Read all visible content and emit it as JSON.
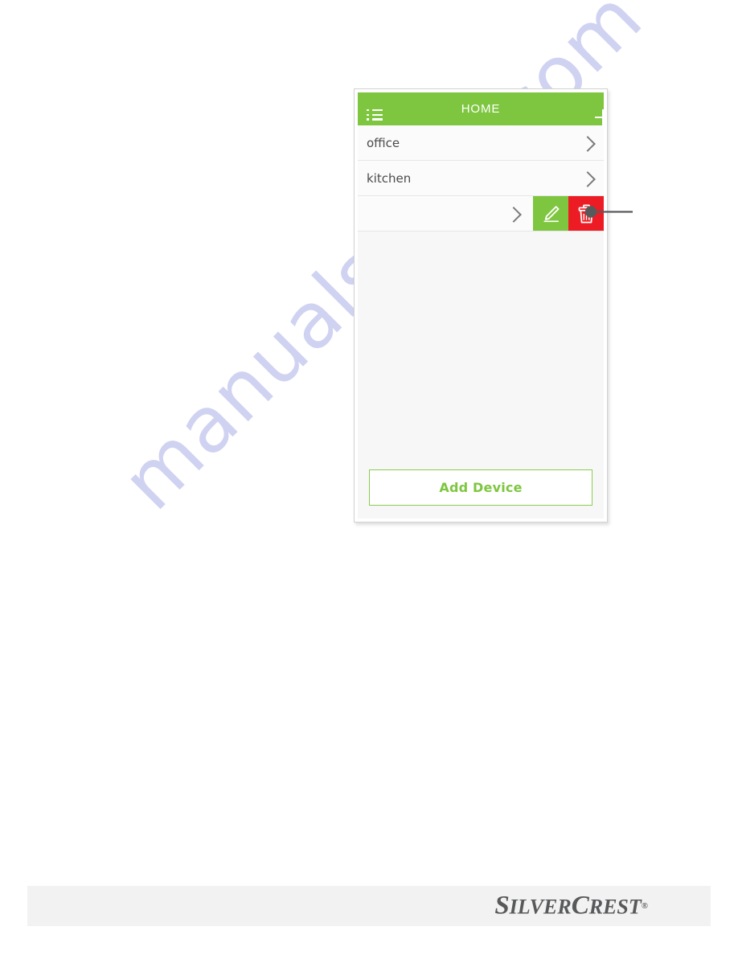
{
  "app": {
    "header": {
      "title": "HOME",
      "menu_icon": "list-icon",
      "add_icon": "plus-icon",
      "background_color": "#7ec63f",
      "text_color": "#ffffff"
    },
    "rooms": [
      {
        "label": "office",
        "chevron_icon": "chevron-right-icon",
        "swiped": false
      },
      {
        "label": "kitchen",
        "chevron_icon": "chevron-right-icon",
        "swiped": false
      },
      {
        "label": "",
        "chevron_icon": "chevron-right-icon",
        "swiped": true
      }
    ],
    "row_actions": {
      "edit": {
        "icon": "pencil-icon",
        "color": "#7ec63f"
      },
      "delete": {
        "icon": "trash-icon",
        "color": "#ed1c24"
      }
    },
    "add_device": {
      "label": "Add Device",
      "border_color": "#8bcb4f",
      "text_color": "#7ec63f"
    }
  },
  "callout": {
    "marker_icon": "callout-dot-marker",
    "line_color": "#58595b"
  },
  "page": {
    "watermark": "manualshive.com",
    "watermark_color": "#c8cbef",
    "brand": {
      "part1_cap": "S",
      "part1_rest": "ILVER",
      "part2_cap": "C",
      "part2_rest": "REST",
      "registered": "®"
    }
  }
}
